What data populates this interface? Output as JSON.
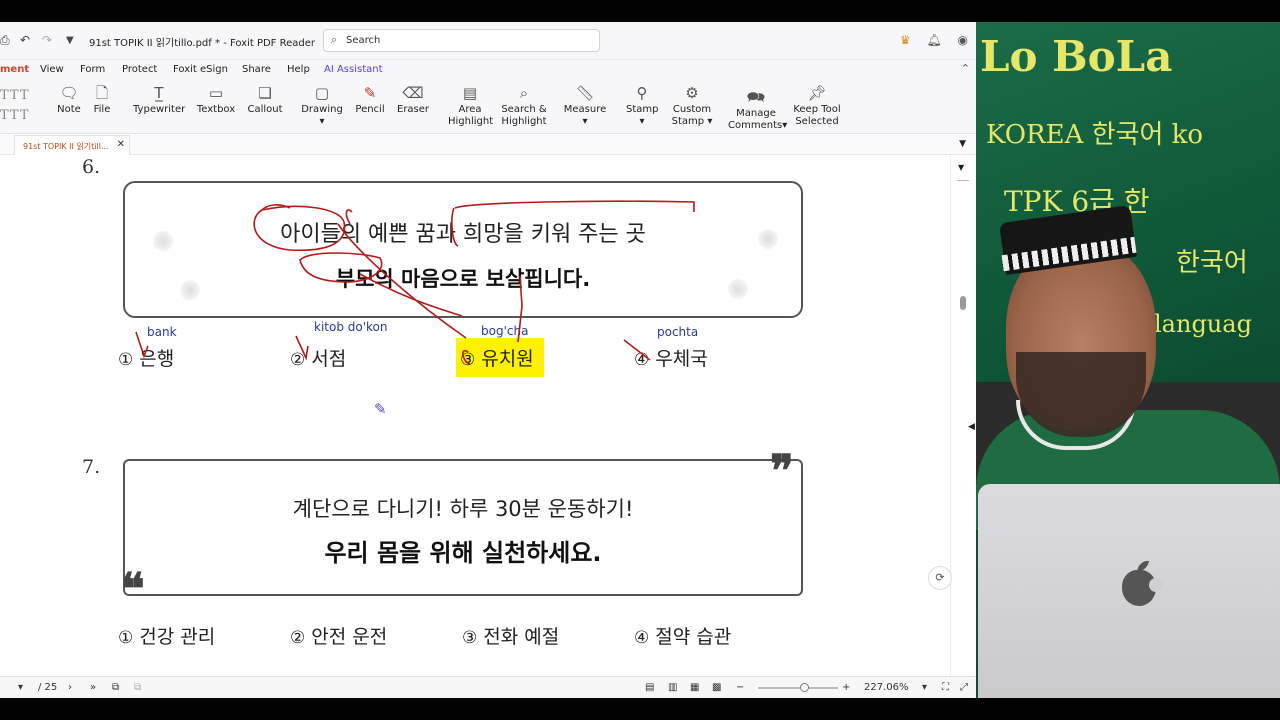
{
  "window": {
    "doc_title": "91st TOPIK II 읽기tillo.pdf * - Foxit PDF Reader",
    "search_placeholder": "Search"
  },
  "menu": [
    "ment",
    "View",
    "Form",
    "Protect",
    "Foxit eSign",
    "Share",
    "Help",
    "AI Assistant"
  ],
  "toolbar": {
    "note": "Note",
    "file": "File",
    "typewriter": "Typewriter",
    "textbox": "Textbox",
    "callout": "Callout",
    "drawing": "Drawing",
    "pencil": "Pencil",
    "eraser": "Eraser",
    "area_highlight_1": "Area",
    "area_highlight_2": "Highlight",
    "search_highlight_1": "Search &",
    "search_highlight_2": "Highlight",
    "measure": "Measure",
    "stamp": "Stamp",
    "custom_stamp_1": "Custom",
    "custom_stamp_2": "Stamp",
    "manage_comments_1": "Manage",
    "manage_comments_2": "Comments",
    "keep_tool_1": "Keep Tool",
    "keep_tool_2": "Selected"
  },
  "tab": {
    "label": "91st TOPIK II 읽기till..."
  },
  "q6": {
    "number": "6.",
    "line1": "아이들의 예쁜 꿈과 희망을 키워 주는 곳",
    "line2": "부모의 마음으로 보살핍니다.",
    "glosses": [
      "bank",
      "kitob do'kon",
      "bog'cha",
      "pochta"
    ],
    "options": [
      {
        "num": "①",
        "text": "은행"
      },
      {
        "num": "②",
        "text": "서점"
      },
      {
        "num": "③",
        "text": "유치원"
      },
      {
        "num": "④",
        "text": "우체국"
      }
    ]
  },
  "q7": {
    "number": "7.",
    "line1": "계단으로 다니기! 하루 30분 운동하기!",
    "line2": "우리 몸을 위해 실천하세요.",
    "options": [
      {
        "num": "①",
        "text": "건강 관리"
      },
      {
        "num": "②",
        "text": "안전 운전"
      },
      {
        "num": "③",
        "text": "전화 예절"
      },
      {
        "num": "④",
        "text": "절약 습관"
      }
    ]
  },
  "status": {
    "page_total": "/ 25",
    "zoom": "227.06%"
  },
  "webcam": {
    "chalk_lines": [
      "Lo BoLa",
      "KOREA 한국어 ko",
      "TPK 6급 한",
      "한국어",
      "languag"
    ]
  },
  "colors": {
    "accent_menu": "#d0452a",
    "ai_assistant": "#5a3fd6",
    "highlight": "#fff200",
    "annotation_ink": "#b21b1b",
    "gloss_ink": "#2b3a8f",
    "chalk": "#e6e66a"
  }
}
